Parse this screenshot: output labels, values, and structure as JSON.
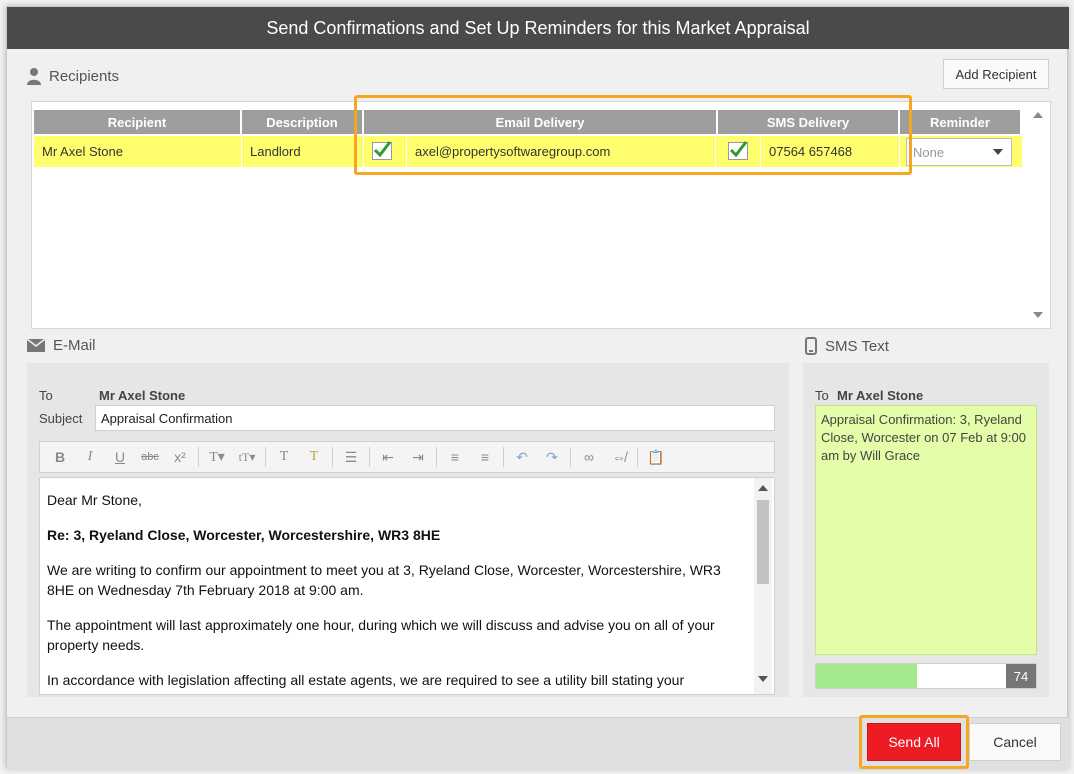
{
  "dialog": {
    "title": "Send Confirmations and Set Up Reminders for this Market Appraisal"
  },
  "recipients": {
    "section_label": "Recipients",
    "add_button": "Add Recipient",
    "columns": {
      "recipient": "Recipient",
      "description": "Description",
      "email": "Email Delivery",
      "sms": "SMS Delivery",
      "reminder": "Reminder"
    },
    "rows": [
      {
        "name": "Mr Axel Stone",
        "description": "Landlord",
        "email_checked": true,
        "email": "axel@propertysoftwaregroup.com",
        "sms_checked": true,
        "phone": "07564 657468",
        "reminder": "None"
      }
    ]
  },
  "email": {
    "section_label": "E-Mail",
    "to_label": "To",
    "to_value": "Mr Axel Stone",
    "subject_label": "Subject",
    "subject_value": "Appraisal Confirmation",
    "toolbar": [
      "bold-icon",
      "italic-icon",
      "underline-icon",
      "strikethrough-icon",
      "superscript-icon",
      "font-icon",
      "font-size-icon",
      "text-color-icon",
      "highlight-icon",
      "bullet-list-icon",
      "outdent-icon",
      "indent-icon",
      "align-left-icon",
      "align-center-icon",
      "undo-icon",
      "redo-icon",
      "link-icon",
      "unlink-icon",
      "paste-text-icon"
    ],
    "body": {
      "greeting": "Dear Mr Stone,",
      "re_line": "Re: 3, Ryeland Close, Worcester, Worcestershire, WR3 8HE",
      "p1": "We are writing to confirm our appointment to meet you at 3, Ryeland Close, Worcester, Worcestershire, WR3 8HE on Wednesday 7th February 2018 at 9:00 am.",
      "p2": "The appointment will last approximately one hour, during which we will discuss and advise you on all of your property needs.",
      "p3": "In accordance with legislation affecting all estate agents, we are required to see a utility bill stating your"
    }
  },
  "sms": {
    "section_label": "SMS Text",
    "to_label": "To",
    "to_value": "Mr Axel Stone",
    "text": "Appraisal Confirmation: 3, Ryeland Close, Worcester on 07 Feb at 9:00 am by Will Grace",
    "char_count": "74",
    "fill_fraction": 0.46
  },
  "footer": {
    "send_all": "Send All",
    "cancel": "Cancel"
  },
  "colors": {
    "titlebar": "#4a4a4a",
    "row_highlight": "#ffff6e",
    "callout": "#f5a623",
    "send_button": "#ed1c24",
    "sms_background": "#e3fda8"
  }
}
